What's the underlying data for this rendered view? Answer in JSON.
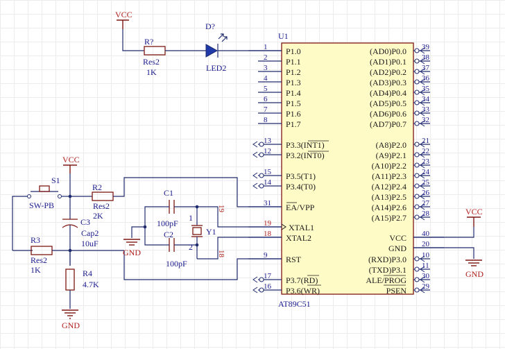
{
  "mcu": {
    "designator": "U1",
    "part": "AT89C51",
    "left_pins": [
      {
        "num": "1",
        "name": "P1.0"
      },
      {
        "num": "2",
        "name": "P1.1"
      },
      {
        "num": "3",
        "name": "P1.2"
      },
      {
        "num": "4",
        "name": "P1.3"
      },
      {
        "num": "5",
        "name": "P1.4"
      },
      {
        "num": "6",
        "name": "P1.5"
      },
      {
        "num": "7",
        "name": "P1.6"
      },
      {
        "num": "8",
        "name": "P1.7"
      },
      {
        "num": "13",
        "name": "P3.3(INT1)"
      },
      {
        "num": "12",
        "name": "P3.2(INT0)"
      },
      {
        "num": "15",
        "name": "P3.5(T1)"
      },
      {
        "num": "14",
        "name": "P3.4(T0)"
      },
      {
        "num": "31",
        "name": "EA/VPP"
      },
      {
        "num": "19",
        "name": "XTAL1"
      },
      {
        "num": "18",
        "name": "XTAL2"
      },
      {
        "num": "9",
        "name": "RST"
      },
      {
        "num": "17",
        "name": "P3.7(RD)"
      },
      {
        "num": "16",
        "name": "P3.6(WR)"
      }
    ],
    "right_pins": [
      {
        "num": "39",
        "name": "(AD0)P0.0"
      },
      {
        "num": "38",
        "name": "(AD1)P0.1"
      },
      {
        "num": "37",
        "name": "(AD2)P0.2"
      },
      {
        "num": "36",
        "name": "(AD3)P0.3"
      },
      {
        "num": "35",
        "name": "(AD4)P0.4"
      },
      {
        "num": "34",
        "name": "(AD5)P0.5"
      },
      {
        "num": "33",
        "name": "(AD6)P0.6"
      },
      {
        "num": "32",
        "name": "(AD7)P0.7"
      },
      {
        "num": "21",
        "name": "(A8)P2.0"
      },
      {
        "num": "22",
        "name": "(A9)P2.1"
      },
      {
        "num": "23",
        "name": "(A10)P2.2"
      },
      {
        "num": "24",
        "name": "(A11)P2.3"
      },
      {
        "num": "25",
        "name": "(A12)P2.4"
      },
      {
        "num": "26",
        "name": "(A13)P2.5"
      },
      {
        "num": "27",
        "name": "(A14)P2.6"
      },
      {
        "num": "28",
        "name": "(A15)P2.7"
      },
      {
        "num": "40",
        "name": "VCC"
      },
      {
        "num": "20",
        "name": "GND"
      },
      {
        "num": "10",
        "name": "(RXD)P3.0"
      },
      {
        "num": "11",
        "name": "(TXD)P3.1"
      },
      {
        "num": "30",
        "name": "ALE/PROG"
      },
      {
        "num": "29",
        "name": "PSEN"
      }
    ]
  },
  "components": {
    "r_led": {
      "ref": "R?",
      "type": "Res2",
      "value": "1K"
    },
    "led": {
      "ref": "D?",
      "type": "LED2"
    },
    "s1": {
      "ref": "S1",
      "type": "SW-PB"
    },
    "r2": {
      "ref": "R2",
      "type": "Res2",
      "value": "2K"
    },
    "c3": {
      "ref": "C3",
      "type": "Cap2",
      "value": "10uF"
    },
    "r3": {
      "ref": "R3",
      "type": "Res2",
      "value": "1K"
    },
    "r4": {
      "ref": "R4",
      "value": "4.7K"
    },
    "c1": {
      "ref": "C1",
      "value": "100pF"
    },
    "c2": {
      "ref": "C2",
      "value": "100pF"
    },
    "y1": {
      "ref": "Y1",
      "pin1": "1",
      "pin2": "2"
    }
  },
  "nets": {
    "vcc_top": "VCC",
    "vcc_left": "VCC",
    "vcc_right": "VCC",
    "gnd_left": "GND",
    "gnd_bottom": "GND",
    "gnd_right": "GND",
    "xtal1_pin_rot": "19",
    "xtal2_pin_rot": "18"
  }
}
